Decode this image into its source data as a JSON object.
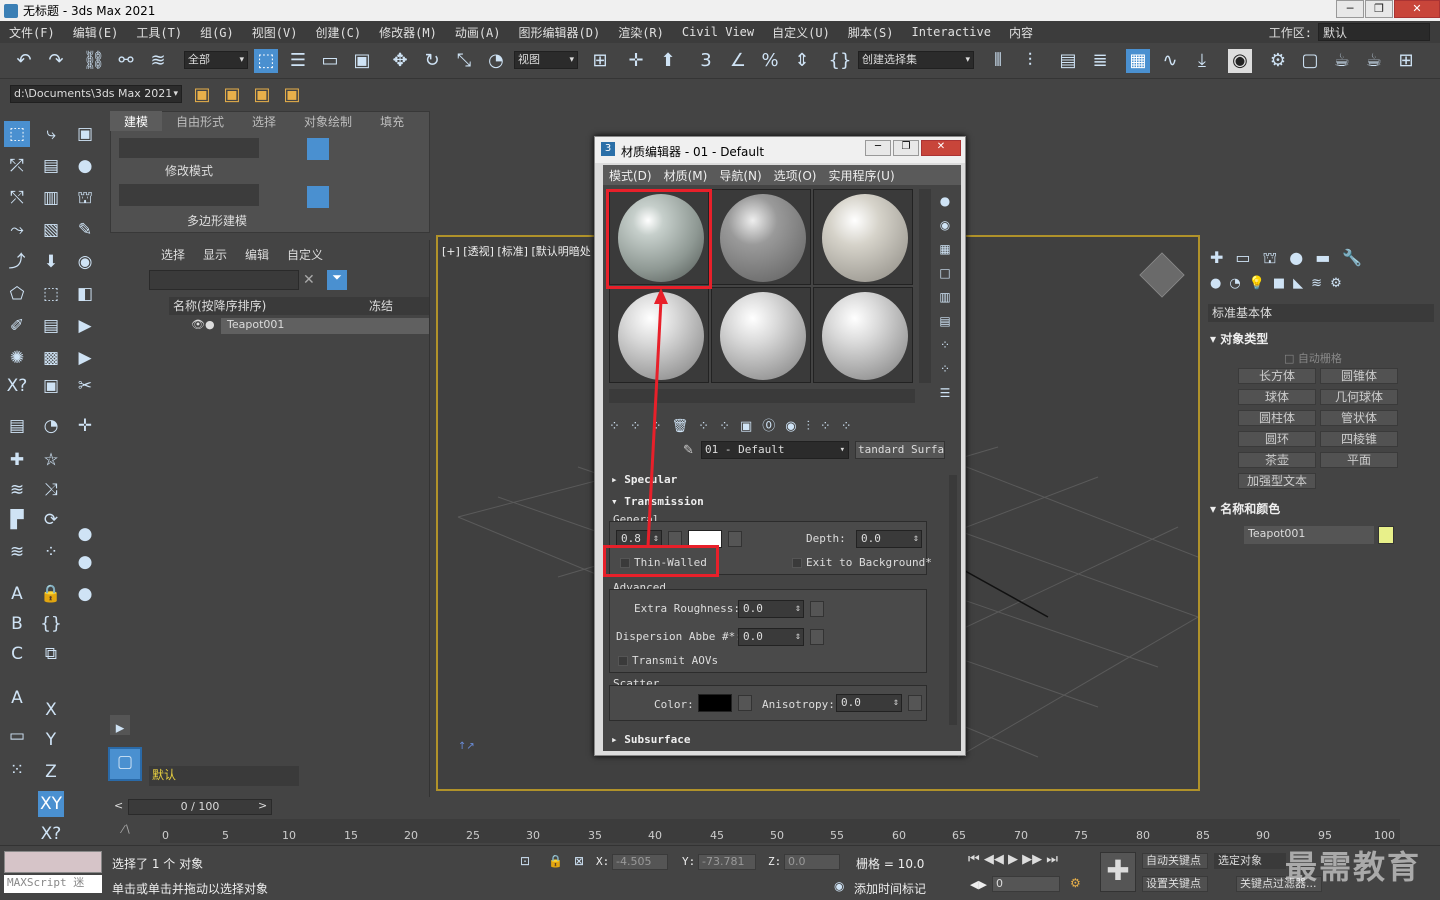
{
  "app": {
    "title": "无标题 - 3ds Max 2021"
  },
  "menu": [
    "文件(F)",
    "编辑(E)",
    "工具(T)",
    "组(G)",
    "视图(V)",
    "创建(C)",
    "修改器(M)",
    "动画(A)",
    "图形编辑器(D)",
    "渲染(R)",
    "Civil View",
    "自定义(U)",
    "脚本(S)",
    "Interactive",
    "内容"
  ],
  "workspace": {
    "label": "工作区:",
    "value": "默认"
  },
  "toolbar": {
    "filter": "全部",
    "refcoord": "视图",
    "selset": "创建选择集",
    "path": "d:\\Documents\\3ds Max 2021"
  },
  "ribbon": {
    "tabs": [
      "建模",
      "自由形式",
      "选择",
      "对象绘制",
      "填充"
    ],
    "group1": "修改模式",
    "group2": "多边形建模"
  },
  "scene": {
    "tabs": [
      "选择",
      "显示",
      "编辑",
      "自定义"
    ],
    "col_name": "名称(按降序排序)",
    "col_freeze": "冻结",
    "item": "Teapot001",
    "layer": "默认"
  },
  "viewport": {
    "label": "[+] [透视] [标准] [默认明暗处"
  },
  "cmd": {
    "category": "标准基本体",
    "rollout_type": "对象类型",
    "autogrid": "自动栅格",
    "buttons": [
      "长方体",
      "圆锥体",
      "球体",
      "几何球体",
      "圆柱体",
      "管状体",
      "圆环",
      "四棱锥",
      "茶壶",
      "平面",
      "加强型文本"
    ],
    "rollout_name": "名称和颜色",
    "obj_name": "Teapot001",
    "obj_color": "#e8f08a"
  },
  "mated": {
    "title": "材质编辑器 - 01 - Default",
    "menu": [
      "模式(D)",
      "材质(M)",
      "导航(N)",
      "选项(O)",
      "实用程序(U)"
    ],
    "mat_name": "01 - Default",
    "mat_type": "tandard Surfac",
    "roll_specular": "Specular",
    "roll_transmission": "Transmission",
    "general": "General",
    "weight": "0.8",
    "depth_label": "Depth:",
    "depth": "0.0",
    "thin_walled": "Thin-Walled",
    "exit_bg": "Exit to Background*",
    "advanced": "Advanced",
    "extra_rough_label": "Extra Roughness:",
    "extra_rough": "0.0",
    "dispersion_label": "Dispersion Abbe #*:",
    "dispersion": "0.0",
    "aovs": "Transmit AOVs",
    "scatter": "Scatter",
    "color_label": "Color:",
    "aniso_label": "Anisotropy:",
    "aniso": "0.0",
    "roll_subsurface": "Subsurface"
  },
  "timeline": {
    "slider": "0 / 100",
    "ticks": [
      "0",
      "5",
      "10",
      "15",
      "20",
      "25",
      "30",
      "35",
      "40",
      "45",
      "50",
      "55",
      "60",
      "65",
      "70",
      "75",
      "80",
      "85",
      "90",
      "95",
      "100"
    ]
  },
  "status": {
    "selected": "选择了 1 个 对象",
    "hint": "单击或单击并拖动以选择对象",
    "maxscript": "MAXScript 迷",
    "x_label": "X:",
    "x": "-4.505",
    "y_label": "Y:",
    "y": "-73.781",
    "z_label": "Z:",
    "z": "0.0",
    "grid": "栅格 = 10.0",
    "addtime": "添加时间标记",
    "autokey": "自动关键点",
    "selobj": "选定对象",
    "setkey": "设置关键点",
    "keyfilter": "关键点过滤器...",
    "frame": "0"
  },
  "logo": "最需教育"
}
